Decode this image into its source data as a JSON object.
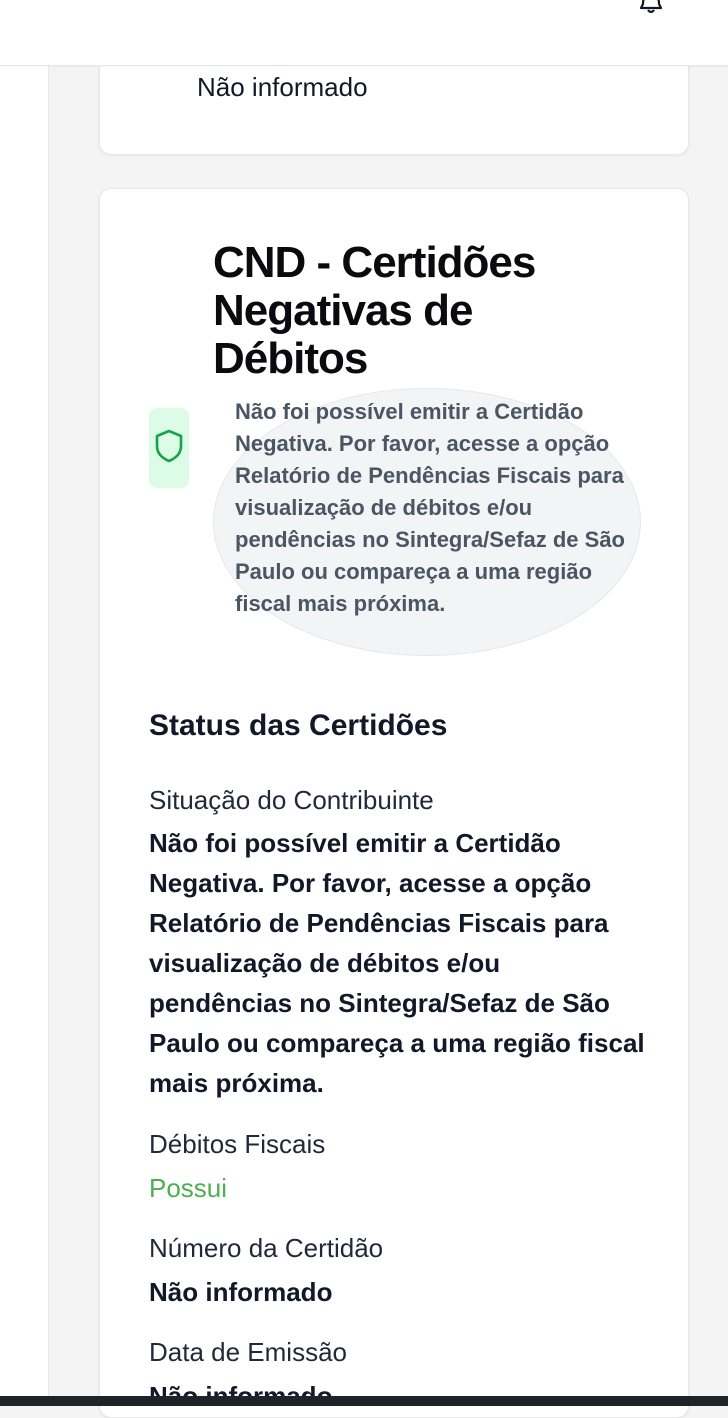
{
  "header": {
    "notifications_icon": "bell-icon"
  },
  "previous_card": {
    "value": "Não informado"
  },
  "cnd": {
    "title": "CND - Certidões Negativas de Débitos",
    "icon": "shield-icon",
    "message": "Não foi possível emitir a Certidão Negativa. Por favor, acesse a opção Relatório de Pendências Fiscais para visualização de débitos e/ou pendências no Sintegra/Sefaz de São Paulo ou compareça a uma região fiscal mais próxima.",
    "status_title": "Status das Certidões",
    "fields": [
      {
        "label": "Situação do Contribuinte",
        "value": "Não foi possível emitir a Certidão Negativa. Por favor, acesse a opção Relatório de Pendências Fiscais para visualização de débitos e/ou pendências no Sintegra/Sefaz de São Paulo ou compareça a uma região fiscal mais próxima."
      },
      {
        "label": "Débitos Fiscais",
        "value": "Possui"
      },
      {
        "label": "Número da Certidão",
        "value": "Não informado"
      },
      {
        "label": "Data de Emissão",
        "value": "Não informado"
      }
    ]
  },
  "colors": {
    "success_green": "#4caf50",
    "icon_bg": "#dcfce7",
    "icon_stroke": "#16a34a"
  }
}
